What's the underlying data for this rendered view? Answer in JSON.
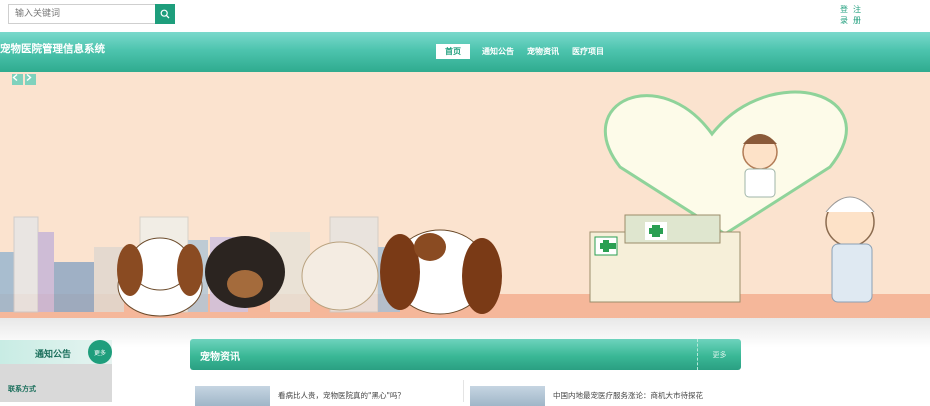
{
  "search": {
    "placeholder": "输入关键词"
  },
  "auth": {
    "login_1": "登",
    "login_2": "录",
    "register_1": "注",
    "register_2": "册"
  },
  "header": {
    "site_title": "宠物医院管理信息系统"
  },
  "nav": [
    {
      "label": "首页",
      "active": true
    },
    {
      "label": "通知公告"
    },
    {
      "label": "宠物资讯"
    },
    {
      "label": "医疗项目"
    }
  ],
  "sidebar": {
    "title": "通知公告",
    "more": "更多",
    "contact": "联系方式"
  },
  "news": {
    "title": "宠物资讯",
    "more": "更多",
    "items": [
      {
        "text": "看病比人贵，宠物医院真的\"黑心\"吗？"
      },
      {
        "text": "中国内地最宠医疗服务涨论：商机大市待探花"
      }
    ]
  },
  "colors": {
    "accent": "#1e9e7c",
    "header_gradient_top": "#7ad9cc",
    "banner_bg": "#fbe3cf"
  },
  "icons": {
    "search": "search-icon",
    "prev": "chevron-left-icon",
    "next": "chevron-right-icon"
  }
}
